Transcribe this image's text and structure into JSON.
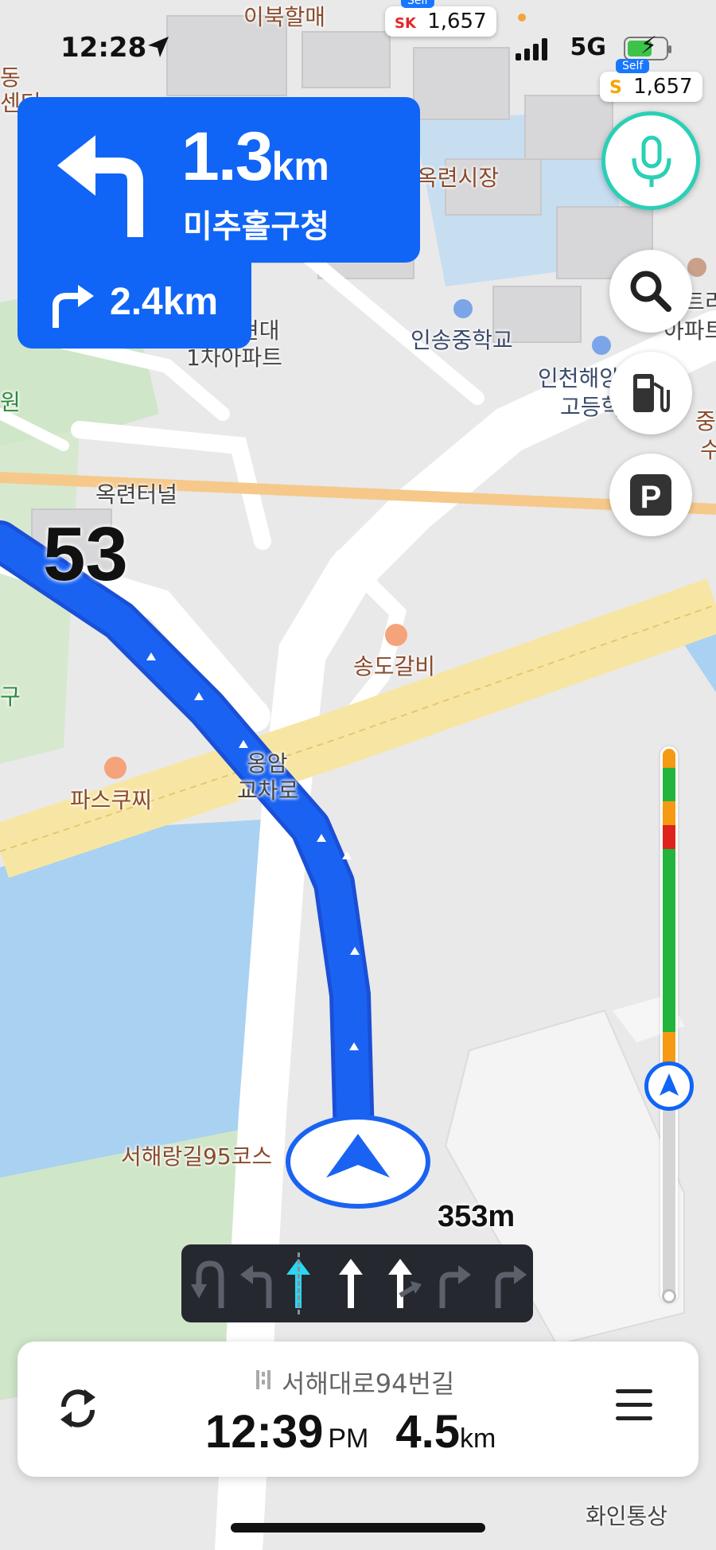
{
  "status_bar": {
    "time": "12:28",
    "network": "5G"
  },
  "fuel_prices": [
    {
      "brand": "SK",
      "self_tag": "Self",
      "price": "1,657"
    },
    {
      "brand": "S",
      "self_tag": "Self",
      "price": "1,657"
    }
  ],
  "guidance": {
    "main_distance": "1.3",
    "main_unit": "km",
    "main_street": "미추홀구청",
    "main_turn": "left",
    "next_distance": "2.4km",
    "next_turn": "right"
  },
  "speed_limit": "53",
  "lane_distance": "353m",
  "lanes": [
    "uturn-left",
    "left",
    "straight-active",
    "straight",
    "straight-right",
    "right",
    "right"
  ],
  "map_labels": {
    "l1": "이북할매",
    "l2": "옥련시장",
    "l3": "인송중학교",
    "l4": "인천해양",
    "l5": "고등학",
    "l6": "현대",
    "l7": "1차아파트",
    "l8": "옥련터널",
    "l9": "송도갈비",
    "l10": "옹암",
    "l11": "교차로",
    "l12": "파스쿠찌",
    "l13": "서해랑길95코스",
    "l14": "화인통상",
    "l15": "트리",
    "l16": "아파트",
    "l17": "중",
    "l18": "수",
    "l19": "동",
    "l20": "센터",
    "l21": "원",
    "l22": "구",
    "l23": "공원"
  },
  "bottom_bar": {
    "road": "서해대로94번길",
    "eta_time": "12:39",
    "eta_ampm": "PM",
    "remaining_distance": "4.5",
    "remaining_unit": "km"
  },
  "colors": {
    "guidance_blue": "#1065f6",
    "route_blue": "#1a63f2",
    "mic_teal": "#2ad0b6",
    "traffic_green": "#22b43c",
    "traffic_orange": "#f59a12",
    "traffic_red": "#e0221c"
  },
  "icons": [
    "location-arrow-icon",
    "signal-icon",
    "battery-icon",
    "mic-icon",
    "search-icon",
    "fuel-pump-icon",
    "parking-icon",
    "reroute-icon",
    "menu-icon",
    "car-position-icon"
  ]
}
